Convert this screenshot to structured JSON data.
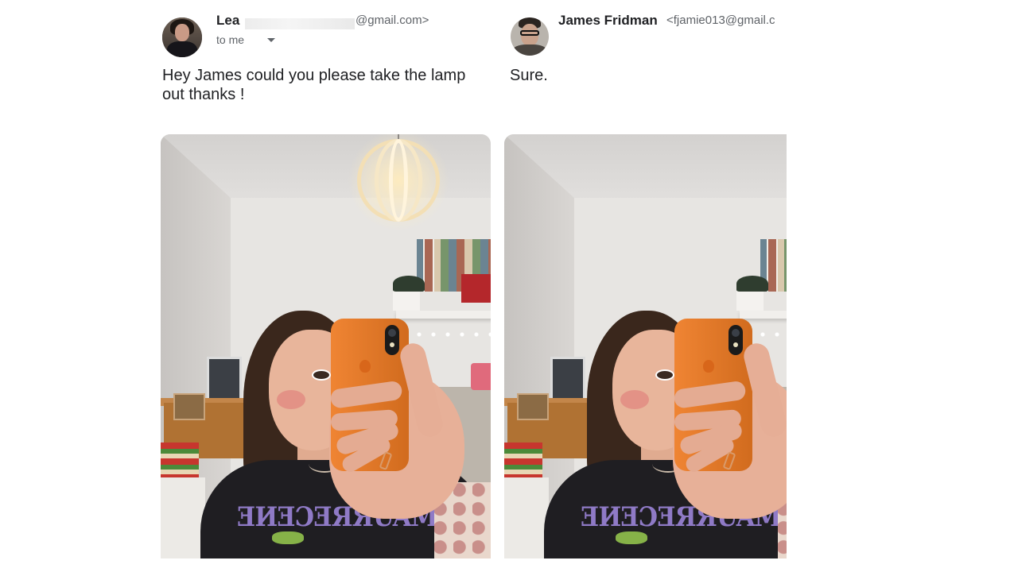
{
  "left_message": {
    "sender_name": "Lea",
    "sender_email_suffix": "@gmail.com>",
    "recipient": "to me",
    "body": "Hey James could you please take the lamp out thanks !",
    "attachment": "photo-with-lamp"
  },
  "right_message": {
    "sender_name": "James Fridman",
    "sender_email": "<fjamie013@gmail.c",
    "body": "Sure.",
    "attachment": "photo-without-lamp"
  },
  "icons": {
    "left_avatar": "avatar-lea",
    "right_avatar": "avatar-james",
    "recipient_dropdown": "chevron-down-icon"
  }
}
